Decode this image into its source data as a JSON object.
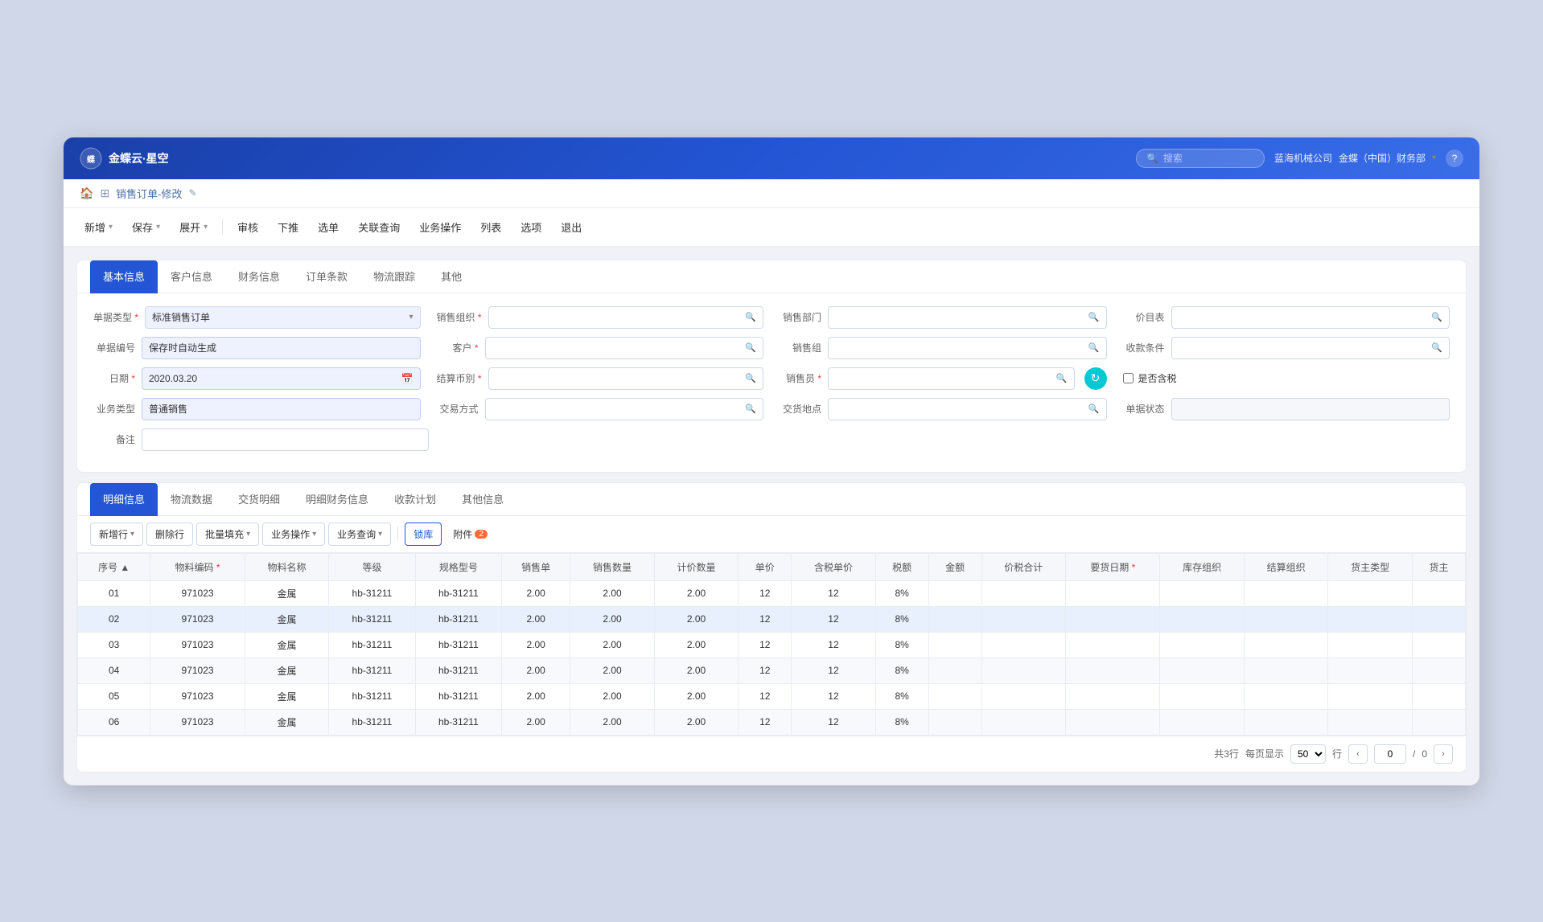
{
  "app": {
    "logo": "金蝶云·星空",
    "search_placeholder": "搜索",
    "company": "蓝海机械公司",
    "dept": "金蝶（中国）财务部",
    "help": "?"
  },
  "breadcrumb": {
    "home": "🏠",
    "grid": "⊞",
    "title": "销售订单-修改",
    "edit_icon": "✎"
  },
  "toolbar": {
    "items": [
      {
        "label": "新增",
        "has_arrow": true
      },
      {
        "label": "保存",
        "has_arrow": true
      },
      {
        "label": "展开",
        "has_arrow": true
      },
      {
        "label": "审核",
        "has_arrow": false
      },
      {
        "label": "下推",
        "has_arrow": false
      },
      {
        "label": "选单",
        "has_arrow": false
      },
      {
        "label": "关联查询",
        "has_arrow": false
      },
      {
        "label": "业务操作",
        "has_arrow": false
      },
      {
        "label": "列表",
        "has_arrow": false
      },
      {
        "label": "选项",
        "has_arrow": false
      },
      {
        "label": "退出",
        "has_arrow": false
      }
    ]
  },
  "basic_info": {
    "tabs": [
      "基本信息",
      "客户信息",
      "财务信息",
      "订单条款",
      "物流跟踪",
      "其他"
    ],
    "active_tab": "基本信息",
    "fields": {
      "bill_type_label": "单据类型",
      "bill_type_value": "标准销售订单",
      "bill_no_label": "单据编号",
      "bill_no_value": "保存时自动生成",
      "date_label": "日期",
      "date_value": "2020.03.20",
      "biz_type_label": "业务类型",
      "biz_type_value": "普通销售",
      "remark_label": "备注",
      "sales_org_label": "销售组织",
      "customer_label": "客户",
      "currency_label": "结算币别",
      "trade_label": "交易方式",
      "sales_dept_label": "销售部门",
      "sales_group_label": "销售组",
      "salesperson_label": "销售员",
      "delivery_addr_label": "交货地点",
      "price_list_label": "价目表",
      "payment_cond_label": "收款条件",
      "tax_include_label": "是否含税",
      "bill_status_label": "单据状态"
    }
  },
  "detail_info": {
    "tabs": [
      "明细信息",
      "物流数据",
      "交货明细",
      "明细财务信息",
      "收款计划",
      "其他信息"
    ],
    "active_tab": "明细信息",
    "toolbar_btns": [
      "新增行",
      "删除行",
      "批量填充",
      "业务操作",
      "业务查询"
    ],
    "lock_btn": "锁库",
    "attach_btn": "附件",
    "attach_count": "2",
    "table_headers": [
      "序号",
      "物料编码",
      "物料名称",
      "等级",
      "规格型号",
      "销售单",
      "销售数量",
      "计价数量",
      "单价",
      "含税单价",
      "税额",
      "金额",
      "价税合计",
      "要货日期",
      "库存组织",
      "结算组织",
      "货主类型",
      "货主"
    ],
    "rows": [
      {
        "seq": "01",
        "code": "971023",
        "name": "金属",
        "grade": "hb-31211",
        "spec": "hb-31211",
        "unit": "2.00",
        "qty": "2.00",
        "price_qty": "2.00",
        "price": "12",
        "tax_price": "12",
        "tax": "8%",
        "amount": "",
        "total": "",
        "req_date": "",
        "stock_org": "",
        "settle_org": "",
        "owner_type": "",
        "owner": "",
        "highlighted": false
      },
      {
        "seq": "02",
        "code": "971023",
        "name": "金属",
        "grade": "hb-31211",
        "spec": "hb-31211",
        "unit": "2.00",
        "qty": "2.00",
        "price_qty": "2.00",
        "price": "12",
        "tax_price": "12",
        "tax": "8%",
        "amount": "",
        "total": "",
        "req_date": "",
        "stock_org": "",
        "settle_org": "",
        "owner_type": "",
        "owner": "",
        "highlighted": true
      },
      {
        "seq": "03",
        "code": "971023",
        "name": "金属",
        "grade": "hb-31211",
        "spec": "hb-31211",
        "unit": "2.00",
        "qty": "2.00",
        "price_qty": "2.00",
        "price": "12",
        "tax_price": "12",
        "tax": "8%",
        "amount": "",
        "total": "",
        "req_date": "",
        "stock_org": "",
        "settle_org": "",
        "owner_type": "",
        "owner": "",
        "highlighted": false
      },
      {
        "seq": "04",
        "code": "971023",
        "name": "金属",
        "grade": "hb-31211",
        "spec": "hb-31211",
        "unit": "2.00",
        "qty": "2.00",
        "price_qty": "2.00",
        "price": "12",
        "tax_price": "12",
        "tax": "8%",
        "amount": "",
        "total": "",
        "req_date": "",
        "stock_org": "",
        "settle_org": "",
        "owner_type": "",
        "owner": "",
        "highlighted": false
      },
      {
        "seq": "05",
        "code": "971023",
        "name": "金属",
        "grade": "hb-31211",
        "spec": "hb-31211",
        "unit": "2.00",
        "qty": "2.00",
        "price_qty": "2.00",
        "price": "12",
        "tax_price": "12",
        "tax": "8%",
        "amount": "",
        "total": "",
        "req_date": "",
        "stock_org": "",
        "settle_org": "",
        "owner_type": "",
        "owner": "",
        "highlighted": false
      },
      {
        "seq": "06",
        "code": "971023",
        "name": "金属",
        "grade": "hb-31211",
        "spec": "hb-31211",
        "unit": "2.00",
        "qty": "2.00",
        "price_qty": "2.00",
        "price": "12",
        "tax_price": "12",
        "tax": "8%",
        "amount": "",
        "total": "",
        "req_date": "",
        "stock_org": "",
        "settle_org": "",
        "owner_type": "",
        "owner": "",
        "highlighted": false
      }
    ]
  },
  "pagination": {
    "total_rows": "共3行",
    "per_page_label": "每页显示",
    "per_page_value": "50",
    "per_page_unit": "行",
    "current_page": "0",
    "total_pages": "0"
  }
}
